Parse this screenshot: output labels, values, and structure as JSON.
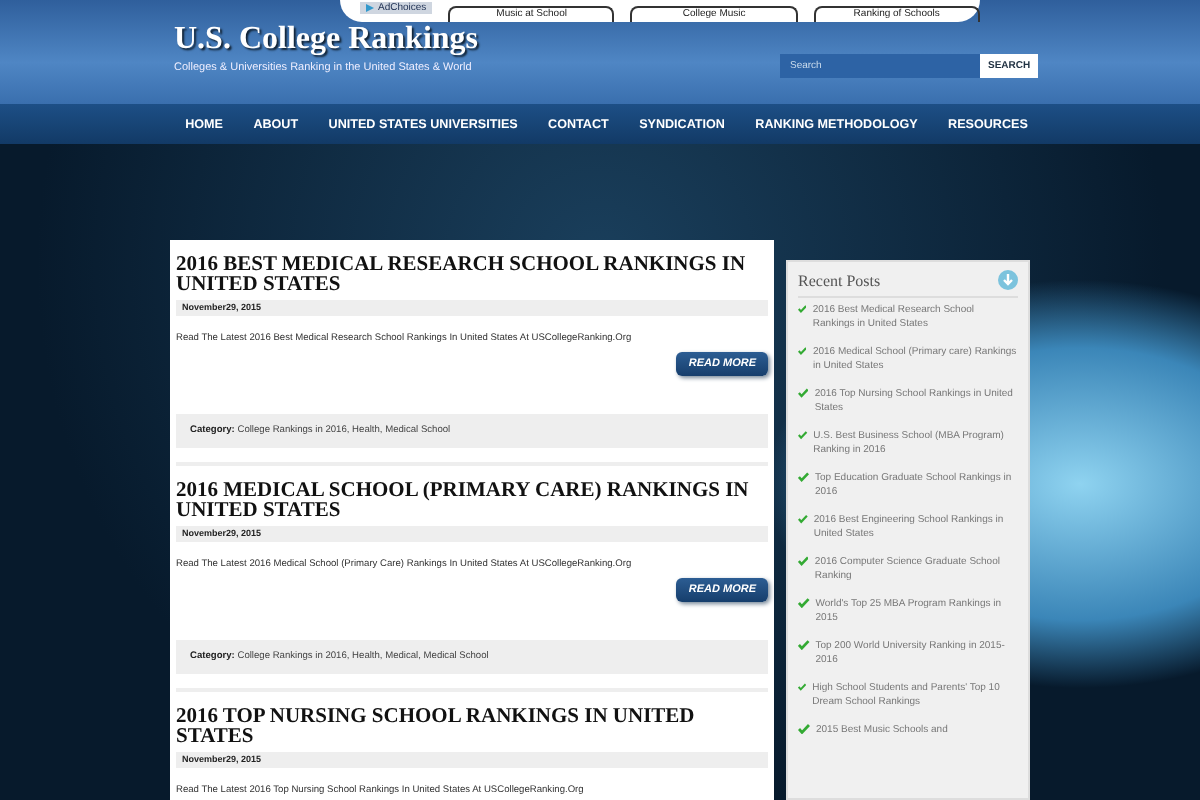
{
  "ad_label": "AdChoices",
  "top_tabs": [
    "Music at School",
    "College Music",
    "Ranking of Schools"
  ],
  "site": {
    "title": "U.S. College Rankings",
    "tagline": "Colleges & Universities Ranking in the United States & World"
  },
  "search": {
    "placeholder": "Search",
    "button": "SEARCH"
  },
  "nav": [
    "HOME",
    "ABOUT",
    "UNITED STATES UNIVERSITIES",
    "CONTACT",
    "SYNDICATION",
    "RANKING METHODOLOGY",
    "RESOURCES"
  ],
  "posts": [
    {
      "title": "2016 BEST MEDICAL RESEARCH SCHOOL RANKINGS IN UNITED STATES",
      "date": "November29, 2015",
      "excerpt": "Read The Latest 2016 Best Medical Research School Rankings In United States At USCollegeRanking.Org",
      "button": "READ MORE",
      "category_label": "Category:",
      "categories": "College Rankings in 2016, Health, Medical School"
    },
    {
      "title": "2016 MEDICAL SCHOOL (PRIMARY CARE) RANKINGS IN UNITED STATES",
      "date": "November29, 2015",
      "excerpt": "Read The Latest 2016 Medical School (Primary Care) Rankings In United States At USCollegeRanking.Org",
      "button": "READ MORE",
      "category_label": "Category:",
      "categories": "College Rankings in 2016, Health, Medical, Medical School"
    },
    {
      "title": "2016 TOP NURSING SCHOOL RANKINGS IN UNITED STATES",
      "date": "November29, 2015",
      "excerpt": "Read The Latest 2016 Top Nursing School Rankings In United States At USCollegeRanking.Org"
    }
  ],
  "recent_posts": {
    "title": "Recent Posts",
    "items": [
      "2016 Best Medical Research School Rankings in United States",
      "2016 Medical School (Primary care) Rankings in United States",
      "2016 Top Nursing School Rankings in United States",
      "U.S. Best Business School (MBA Program) Ranking in 2016",
      "Top Education Graduate School Rankings in 2016",
      "2016 Best Engineering School Rankings in United States",
      "2016 Computer Science Graduate School Ranking",
      "World's Top 25 MBA Program Rankings in 2015",
      "Top 200 World University Ranking in 2015-2016",
      "High School Students and Parents' Top 10 Dream School Rankings",
      "2015 Best Music Schools and"
    ]
  }
}
